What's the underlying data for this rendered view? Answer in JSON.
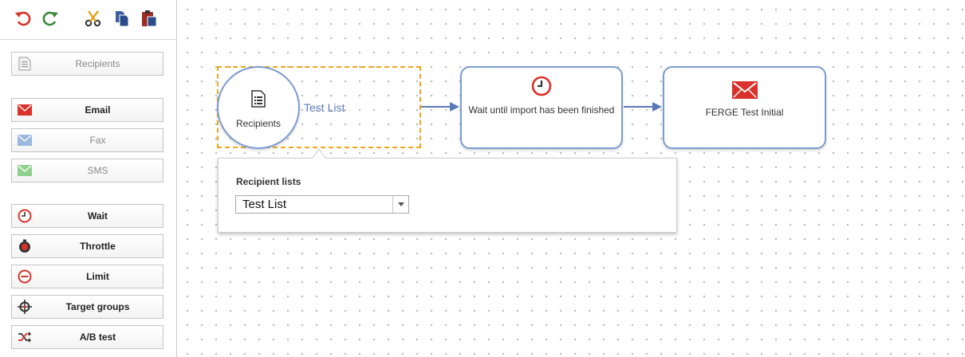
{
  "colors": {
    "node_border": "#7b9bd0",
    "selection_dashes": "#f0a619",
    "icon_red": "#d9322b",
    "icon_green": "#3a8a3a",
    "link_blue": "#5a79b8"
  },
  "toolbar": {
    "buttons": [
      {
        "name": "undo",
        "icon": "undo-icon"
      },
      {
        "name": "redo",
        "icon": "redo-icon"
      },
      {
        "name": "cut",
        "icon": "scissors-icon"
      },
      {
        "name": "copy",
        "icon": "copy-icon"
      },
      {
        "name": "paste",
        "icon": "clipboard-icon"
      }
    ]
  },
  "palette": {
    "recipients": {
      "label": "Recipients",
      "icon": "list-icon",
      "enabled": false
    },
    "email": {
      "label": "Email",
      "icon": "envelope-icon",
      "enabled": true
    },
    "fax": {
      "label": "Fax",
      "icon": "envelope-icon",
      "enabled": false
    },
    "sms": {
      "label": "SMS",
      "icon": "envelope-icon",
      "enabled": false
    },
    "wait": {
      "label": "Wait",
      "icon": "clock-icon",
      "enabled": true
    },
    "throttle": {
      "label": "Throttle",
      "icon": "stopwatch-icon",
      "enabled": true
    },
    "limit": {
      "label": "Limit",
      "icon": "minus-circle-icon",
      "enabled": true
    },
    "target_groups": {
      "label": "Target groups",
      "icon": "crosshair-icon",
      "enabled": true
    },
    "ab_test": {
      "label": "A/B test",
      "icon": "shuffle-icon",
      "enabled": true
    }
  },
  "canvas": {
    "recipients_node": {
      "label": "Recipients",
      "list_name": "Test List",
      "icon": "list-icon"
    },
    "wait_node": {
      "label": "Wait until import has been finished",
      "icon": "clock-icon"
    },
    "email_node": {
      "label": "FERGE Test Initial",
      "icon": "envelope-icon"
    }
  },
  "popup": {
    "title": "Recipient lists",
    "select_value": "Test List"
  }
}
